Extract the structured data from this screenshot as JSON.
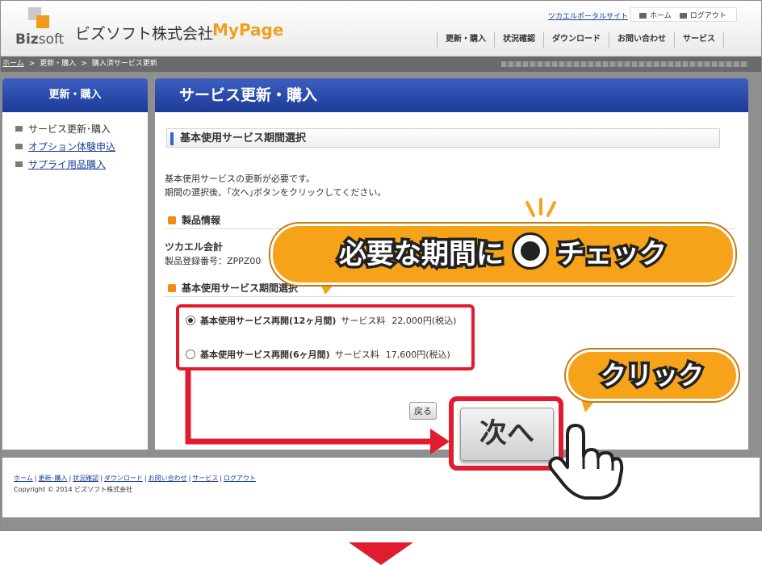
{
  "header": {
    "logo_text_biz": "Biz",
    "logo_text_soft": "soft",
    "company_name": "ビズソフト株式会社",
    "mypage_label": "MyPage",
    "portal_link": "ツカエルポータルサイト",
    "home_link": "ホーム",
    "logout_link": "ログアウト",
    "nav": [
      "更新・購入",
      "状況確認",
      "ダウンロード",
      "お問い合わせ",
      "サービス"
    ]
  },
  "breadcrumb": {
    "home": "ホーム",
    "sep": ">",
    "level1": "更新・購入",
    "level2": "購入済サービス更新"
  },
  "sidebar": {
    "title": "更新・購入",
    "items": [
      {
        "label": "サービス更新･購入",
        "link": false
      },
      {
        "label": "オプション体験申込",
        "link": true
      },
      {
        "label": "サプライ用品購入",
        "link": true
      }
    ]
  },
  "main": {
    "title": "サービス更新・購入",
    "section_title": "基本使用サービス期間選択",
    "intro_line1": "基本使用サービスの更新が必要です。",
    "intro_line2": "期間の選択後、｢次へ｣ボタンをクリックしてください。",
    "product_heading": "製品情報",
    "product_name": "ツカエル会計",
    "product_reg": "製品登録番号：ZPPZ00",
    "period_heading": "基本使用サービス期間選択",
    "options": [
      {
        "name": "基本使用サービス再開(12ヶ月間)",
        "fee_label": "サービス料",
        "fee": "22,000円(税込)",
        "selected": true
      },
      {
        "name": "基本使用サービス再開(6ヶ月間)",
        "fee_label": "サービス料",
        "fee": "17,600円(税込)",
        "selected": false
      }
    ],
    "back_button": "戻る",
    "next_button": "次へ"
  },
  "footer": {
    "links": [
      "ホーム",
      "更新･購入",
      "状況確認",
      "ダウンロード",
      "お問い合わせ",
      "サービス",
      "ログアウト"
    ],
    "copyright": "Copyright © 2014 ビズソフト株式会社"
  },
  "callouts": {
    "check_before": "必要な期間に",
    "check_after": "チェック",
    "click": "クリック"
  },
  "colors": {
    "accent_orange": "#f6a31a",
    "highlight_red": "#e01d30",
    "header_blue": "#1c3a98",
    "link_blue": "#1a3e9a"
  }
}
